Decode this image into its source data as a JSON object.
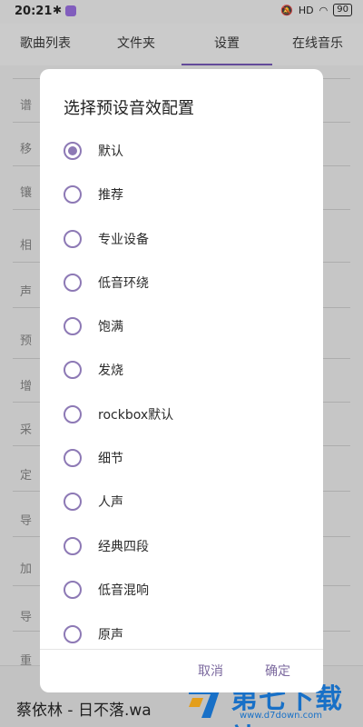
{
  "status_bar": {
    "time": "20:21",
    "signal": "HD",
    "battery": "90"
  },
  "tabs": [
    {
      "label": "歌曲列表"
    },
    {
      "label": "文件夹"
    },
    {
      "label": "设置"
    },
    {
      "label": "在线音乐"
    }
  ],
  "settings_rows": [
    "谱",
    "移",
    "镶",
    "相",
    "声",
    "预",
    "增",
    "采",
    "定",
    "导",
    "加",
    "导",
    "重"
  ],
  "now_playing": {
    "title": "蔡依林 - 日不落.wa"
  },
  "watermark": {
    "text": "第七下载站",
    "url": "www.d7down.com"
  },
  "dialog": {
    "title": "选择预设音效配置",
    "selected_index": 0,
    "options": [
      {
        "label": "默认"
      },
      {
        "label": "推荐"
      },
      {
        "label": "专业设备"
      },
      {
        "label": "低音环绕"
      },
      {
        "label": "饱满"
      },
      {
        "label": "发烧"
      },
      {
        "label": "rockbox默认"
      },
      {
        "label": "细节"
      },
      {
        "label": "人声"
      },
      {
        "label": "经典四段"
      },
      {
        "label": "低音混响"
      },
      {
        "label": "原声"
      }
    ],
    "cancel_label": "取消",
    "confirm_label": "确定"
  },
  "colors": {
    "accent": "#8d79b5",
    "tab_indicator": "#6a4fa3",
    "watermark": "#1a78d4"
  }
}
